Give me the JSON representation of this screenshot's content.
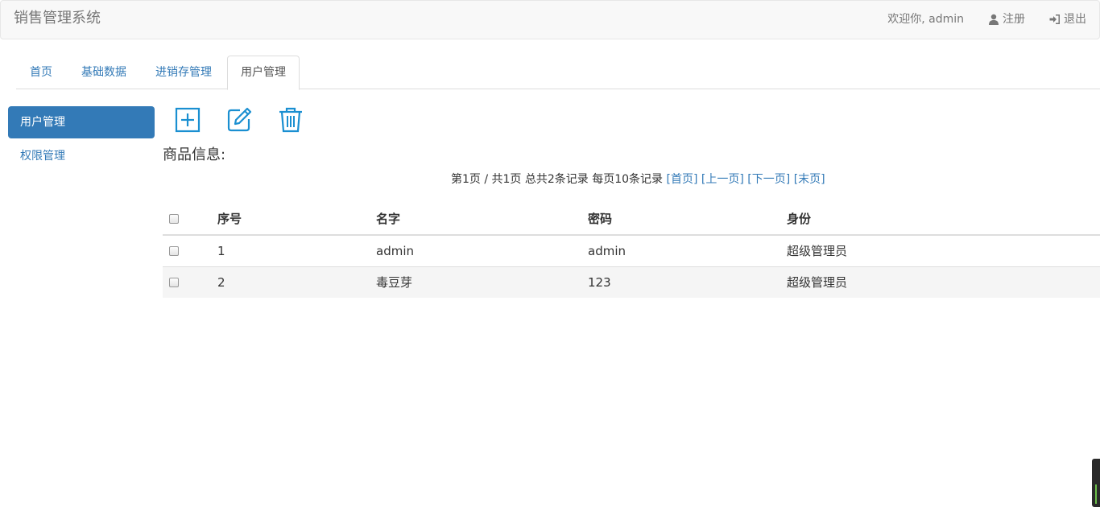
{
  "navbar": {
    "brand": "销售管理系统",
    "welcome": "欢迎你, admin",
    "register": "注册",
    "logout": "退出"
  },
  "tabs": [
    {
      "label": "首页"
    },
    {
      "label": "基础数据"
    },
    {
      "label": "进销存管理"
    },
    {
      "label": "用户管理"
    }
  ],
  "sidebar": {
    "items": [
      {
        "label": "用户管理"
      },
      {
        "label": "权限管理"
      }
    ]
  },
  "toolbar": {
    "icons": [
      "add-icon",
      "edit-icon",
      "delete-icon"
    ],
    "icon_color": "#1a8fd1"
  },
  "section_title": "商品信息:",
  "pager": {
    "info": "第1页 / 共1页  总共2条记录 每页10条记录",
    "first": "[首页]",
    "prev": "[上一页]",
    "next": "[下一页]",
    "last": "[末页]"
  },
  "table": {
    "headers": [
      "序号",
      "名字",
      "密码",
      "身份"
    ],
    "rows": [
      {
        "seq": "1",
        "name": "admin",
        "password": "admin",
        "role": "超级管理员"
      },
      {
        "seq": "2",
        "name": "毒豆芽",
        "password": "123",
        "role": "超级管理员"
      }
    ]
  },
  "colors": {
    "accent": "#337ab7",
    "navbar_bg": "#f8f8f8",
    "stripe": "#f5f5f5"
  }
}
